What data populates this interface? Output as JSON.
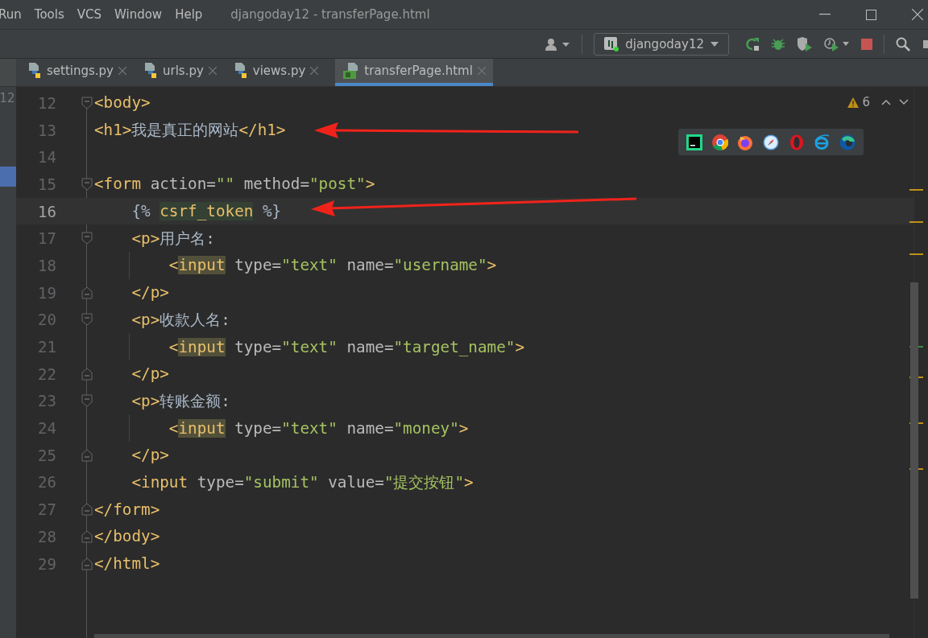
{
  "menu": [
    {
      "label": "Run"
    },
    {
      "label": "Tools"
    },
    {
      "label": "VCS"
    },
    {
      "label": "Window"
    },
    {
      "label": "Help"
    }
  ],
  "window": {
    "title": "djangoday12 - transferPage.html"
  },
  "run_config": {
    "label": "djangoday12"
  },
  "tabs": [
    {
      "label": "settings.py",
      "kind": "python",
      "selected": false
    },
    {
      "label": "urls.py",
      "kind": "python",
      "selected": false
    },
    {
      "label": "views.py",
      "kind": "python",
      "selected": false
    },
    {
      "label": "transferPage.html",
      "kind": "html",
      "selected": true
    }
  ],
  "side_strip": {
    "text": "12"
  },
  "inspections": {
    "warnings": "6"
  },
  "lines": [
    {
      "number": "12",
      "fold_start": true,
      "fold_end": false,
      "current": false,
      "guide": false,
      "tokens": [
        {
          "t": "<body>",
          "kind": "tag"
        }
      ]
    },
    {
      "number": "13",
      "fold_start": false,
      "fold_end": false,
      "current": false,
      "guide": false,
      "tokens": [
        {
          "t": "<h1>",
          "kind": "tag"
        },
        {
          "t": "我是真正的网站",
          "kind": "text"
        },
        {
          "t": "</h1>",
          "kind": "tag"
        }
      ]
    },
    {
      "number": "14",
      "fold_start": false,
      "fold_end": false,
      "current": false,
      "guide": false
    },
    {
      "number": "15",
      "fold_start": true,
      "fold_end": false,
      "current": false,
      "guide": false,
      "tokens": [
        {
          "t": "<form",
          "kind": "tag"
        },
        {
          "t": " action=",
          "kind": "attr"
        },
        {
          "t": "\"\"",
          "kind": "str"
        },
        {
          "t": " method=",
          "kind": "attr"
        },
        {
          "t": "\"post\"",
          "kind": "str"
        },
        {
          "t": ">",
          "kind": "tag"
        }
      ]
    },
    {
      "number": "16",
      "fold_start": false,
      "fold_end": false,
      "current": true,
      "guide": false,
      "tokens": [
        {
          "t": "    {% ",
          "kind": "text"
        },
        {
          "t": "csrf_token",
          "kind": "tmpl"
        },
        {
          "t": " %}",
          "kind": "text"
        }
      ]
    },
    {
      "number": "17",
      "fold_start": true,
      "fold_end": false,
      "current": false,
      "guide": false,
      "tokens": [
        {
          "t": "    <p>",
          "kind": "tag"
        },
        {
          "t": "用户名:",
          "kind": "text"
        }
      ]
    },
    {
      "number": "18",
      "fold_start": false,
      "fold_end": false,
      "current": false,
      "guide": true,
      "tokens": [
        {
          "t": "        <",
          "kind": "tag"
        },
        {
          "t": "input",
          "kind": "match"
        },
        {
          "t": " type=",
          "kind": "attr"
        },
        {
          "t": "\"text\"",
          "kind": "str"
        },
        {
          "t": " name=",
          "kind": "attr"
        },
        {
          "t": "\"username\"",
          "kind": "str"
        },
        {
          "t": ">",
          "kind": "tag"
        }
      ]
    },
    {
      "number": "19",
      "fold_start": false,
      "fold_end": true,
      "current": false,
      "guide": false,
      "tokens": [
        {
          "t": "    </p>",
          "kind": "tag"
        }
      ]
    },
    {
      "number": "20",
      "fold_start": true,
      "fold_end": false,
      "current": false,
      "guide": false,
      "tokens": [
        {
          "t": "    <p>",
          "kind": "tag"
        },
        {
          "t": "收款人名:",
          "kind": "text"
        }
      ]
    },
    {
      "number": "21",
      "fold_start": false,
      "fold_end": false,
      "current": false,
      "guide": true,
      "tokens": [
        {
          "t": "        <",
          "kind": "tag"
        },
        {
          "t": "input",
          "kind": "match"
        },
        {
          "t": " type=",
          "kind": "attr"
        },
        {
          "t": "\"text\"",
          "kind": "str"
        },
        {
          "t": " name=",
          "kind": "attr"
        },
        {
          "t": "\"target_name\"",
          "kind": "str"
        },
        {
          "t": ">",
          "kind": "tag"
        }
      ]
    },
    {
      "number": "22",
      "fold_start": false,
      "fold_end": true,
      "current": false,
      "guide": false,
      "tokens": [
        {
          "t": "    </p>",
          "kind": "tag"
        }
      ]
    },
    {
      "number": "23",
      "fold_start": true,
      "fold_end": false,
      "current": false,
      "guide": false,
      "tokens": [
        {
          "t": "    <p>",
          "kind": "tag"
        },
        {
          "t": "转账金额:",
          "kind": "text"
        }
      ]
    },
    {
      "number": "24",
      "fold_start": false,
      "fold_end": false,
      "current": false,
      "guide": true,
      "tokens": [
        {
          "t": "        <",
          "kind": "tag"
        },
        {
          "t": "input",
          "kind": "match"
        },
        {
          "t": " type=",
          "kind": "attr"
        },
        {
          "t": "\"text\"",
          "kind": "str"
        },
        {
          "t": " name=",
          "kind": "attr"
        },
        {
          "t": "\"money\"",
          "kind": "str"
        },
        {
          "t": ">",
          "kind": "tag"
        }
      ]
    },
    {
      "number": "25",
      "fold_start": false,
      "fold_end": true,
      "current": false,
      "guide": false,
      "tokens": [
        {
          "t": "    </p>",
          "kind": "tag"
        }
      ]
    },
    {
      "number": "26",
      "fold_start": false,
      "fold_end": false,
      "current": false,
      "guide": false,
      "tokens": [
        {
          "t": "    <input",
          "kind": "tag"
        },
        {
          "t": " type=",
          "kind": "attr"
        },
        {
          "t": "\"submit\"",
          "kind": "str"
        },
        {
          "t": " value=",
          "kind": "attr"
        },
        {
          "t": "\"提交按钮\"",
          "kind": "str"
        },
        {
          "t": ">",
          "kind": "tag"
        }
      ]
    },
    {
      "number": "27",
      "fold_start": false,
      "fold_end": true,
      "current": false,
      "guide": false,
      "tokens": [
        {
          "t": "</form>",
          "kind": "tag"
        }
      ]
    },
    {
      "number": "28",
      "fold_start": false,
      "fold_end": true,
      "current": false,
      "guide": false,
      "tokens": [
        {
          "t": "</body>",
          "kind": "tag"
        }
      ]
    },
    {
      "number": "29",
      "fold_start": false,
      "fold_end": true,
      "current": false,
      "guide": false,
      "tokens": [
        {
          "t": "</html>",
          "kind": "tag"
        }
      ]
    }
  ]
}
